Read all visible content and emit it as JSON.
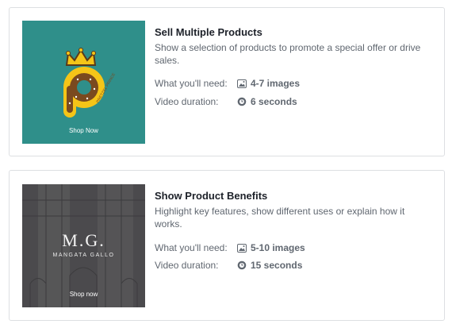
{
  "cards": [
    {
      "title": "Sell Multiple Products",
      "description": "Show a selection of products to promote a special offer or drive sales.",
      "needs_label": "What you'll need:",
      "needs_value": "4-7 images",
      "duration_label": "Video duration:",
      "duration_value": "6 seconds",
      "thumb_cta": "Shop Now",
      "thumb_color": "#2f8f8a"
    },
    {
      "title": "Show Product Benefits",
      "description": "Highlight key features, show different uses or explain how it works.",
      "needs_label": "What you'll need:",
      "needs_value": "5-10 images",
      "duration_label": "Video duration:",
      "duration_value": "15 seconds",
      "thumb_cta": "Shop now",
      "logo_text": "M.G.",
      "logo_sub": "MANGATA GALLO"
    }
  ],
  "icons": {
    "images": "image-icon",
    "duration": "video-duration-icon"
  }
}
